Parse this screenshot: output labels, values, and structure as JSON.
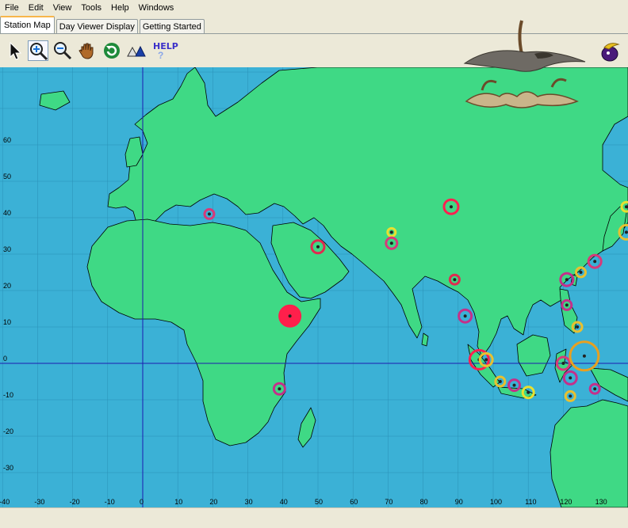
{
  "menu": [
    "File",
    "Edit",
    "View",
    "Tools",
    "Help",
    "Windows"
  ],
  "tabs": [
    {
      "label": "Station Map",
      "active": true
    },
    {
      "label": "Day Viewer Display",
      "active": false
    },
    {
      "label": "Getting Started",
      "active": false
    }
  ],
  "toolbar": {
    "tools": [
      "pointer-icon",
      "zoom-in-icon",
      "zoom-out-icon",
      "pan-hand-icon",
      "refresh-icon",
      "triangles-icon"
    ],
    "help_label": "HELP",
    "help_mark": "?"
  },
  "map": {
    "colors": {
      "ocean": "#3bb1d6",
      "land": "#3fd985",
      "grid": "#2a90b6",
      "axis": "#1c1cb0"
    },
    "y_ticks": [
      60,
      50,
      40,
      30,
      20,
      10,
      0,
      -10,
      -20,
      -30
    ],
    "x_ticks": [
      -40,
      -30,
      -20,
      -10,
      0,
      10,
      20,
      30,
      40,
      50,
      60,
      70,
      80,
      90,
      100,
      110,
      120,
      130
    ],
    "stations": [
      {
        "lon": 19,
        "lat": 41,
        "color": "#d63a7a",
        "size": 6
      },
      {
        "lon": 50,
        "lat": 32,
        "color": "#e02a50",
        "size": 8
      },
      {
        "lon": 42,
        "lat": 13,
        "color": "#ff1f4b",
        "size": 14,
        "filled": true
      },
      {
        "lon": 39,
        "lat": -7,
        "color": "#c4308a",
        "size": 7
      },
      {
        "lon": 71,
        "lat": 36,
        "color": "#e8e030",
        "size": 5
      },
      {
        "lon": 71,
        "lat": 33,
        "color": "#d63a7a",
        "size": 7
      },
      {
        "lon": 88,
        "lat": 43,
        "color": "#ff2050",
        "size": 9
      },
      {
        "lon": 89,
        "lat": 23,
        "color": "#e02a50",
        "size": 6
      },
      {
        "lon": 92,
        "lat": 13,
        "color": "#c4308a",
        "size": 8
      },
      {
        "lon": 96,
        "lat": 1,
        "color": "#ff2050",
        "size": 12
      },
      {
        "lon": 98,
        "lat": 1,
        "color": "#e8c030",
        "size": 8
      },
      {
        "lon": 102,
        "lat": -5,
        "color": "#e8c030",
        "size": 6
      },
      {
        "lon": 106,
        "lat": -6,
        "color": "#c4308a",
        "size": 7
      },
      {
        "lon": 110,
        "lat": -8,
        "color": "#e8e030",
        "size": 7
      },
      {
        "lon": 120,
        "lat": 0,
        "color": "#d63a7a",
        "size": 8
      },
      {
        "lon": 122,
        "lat": -4,
        "color": "#c4308a",
        "size": 8
      },
      {
        "lon": 122,
        "lat": -9,
        "color": "#e8c030",
        "size": 6
      },
      {
        "lon": 129,
        "lat": -7,
        "color": "#c4308a",
        "size": 6
      },
      {
        "lon": 126,
        "lat": 2,
        "color": "#e8a020",
        "size": 18
      },
      {
        "lon": 124,
        "lat": 10,
        "color": "#e8c030",
        "size": 6
      },
      {
        "lon": 121,
        "lat": 16,
        "color": "#c4308a",
        "size": 6
      },
      {
        "lon": 121,
        "lat": 23,
        "color": "#c4308a",
        "size": 8
      },
      {
        "lon": 125,
        "lat": 25,
        "color": "#e8c030",
        "size": 6
      },
      {
        "lon": 129,
        "lat": 28,
        "color": "#d63a7a",
        "size": 8
      },
      {
        "lon": 138,
        "lat": 36,
        "color": "#e8c030",
        "size": 9
      },
      {
        "lon": 138,
        "lat": 43,
        "color": "#e8e030",
        "size": 6
      }
    ]
  }
}
